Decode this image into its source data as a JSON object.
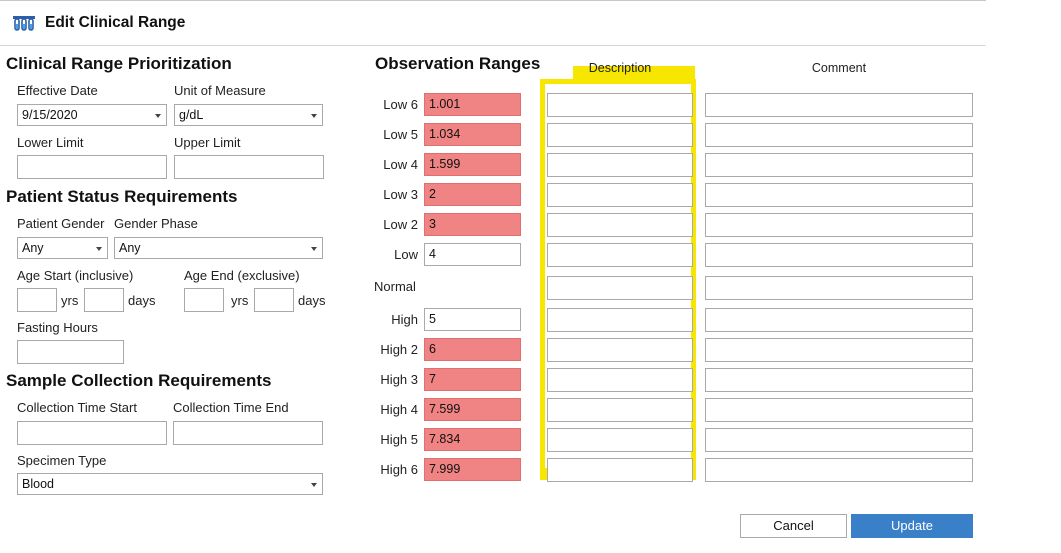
{
  "window": {
    "title": "Edit Clinical Range",
    "icon": "lab-tubes-icon"
  },
  "prioritization": {
    "heading": "Clinical Range Prioritization",
    "effective_date_label": "Effective Date",
    "effective_date_value": "9/15/2020",
    "unit_label": "Unit of Measure",
    "unit_value": "g/dL",
    "lower_limit_label": "Lower Limit",
    "lower_limit_value": "",
    "upper_limit_label": "Upper Limit",
    "upper_limit_value": ""
  },
  "patient": {
    "heading": "Patient Status Requirements",
    "gender_label": "Patient Gender",
    "gender_value": "Any",
    "phase_label": "Gender Phase",
    "phase_value": "Any",
    "age_start_label": "Age Start (inclusive)",
    "age_end_label": "Age End (exclusive)",
    "yrs_label": "yrs",
    "days_label": "days",
    "fasting_label": "Fasting Hours"
  },
  "sample": {
    "heading": "Sample Collection Requirements",
    "time_start_label": "Collection Time Start",
    "time_end_label": "Collection Time End",
    "specimen_label": "Specimen Type",
    "specimen_value": "Blood"
  },
  "observation": {
    "heading": "Observation Ranges",
    "description_header": "Description",
    "comment_header": "Comment",
    "highlight_color": "#f7e600",
    "abnormal_color": "#f08383",
    "rows": [
      {
        "label": "Low 6",
        "value": "1.001",
        "abnormal": true
      },
      {
        "label": "Low 5",
        "value": "1.034",
        "abnormal": true
      },
      {
        "label": "Low 4",
        "value": "1.599",
        "abnormal": true
      },
      {
        "label": "Low 3",
        "value": "2",
        "abnormal": true
      },
      {
        "label": "Low 2",
        "value": "3",
        "abnormal": true
      },
      {
        "label": "Low",
        "value": "4",
        "abnormal": false
      },
      {
        "label": "Normal",
        "value": "",
        "abnormal": false,
        "no_input": true
      },
      {
        "label": "High",
        "value": "5",
        "abnormal": false
      },
      {
        "label": "High 2",
        "value": "6",
        "abnormal": true
      },
      {
        "label": "High 3",
        "value": "7",
        "abnormal": true
      },
      {
        "label": "High 4",
        "value": "7.599",
        "abnormal": true
      },
      {
        "label": "High 5",
        "value": "7.834",
        "abnormal": true
      },
      {
        "label": "High 6",
        "value": "7.999",
        "abnormal": true
      }
    ]
  },
  "buttons": {
    "cancel": "Cancel",
    "update": "Update"
  }
}
